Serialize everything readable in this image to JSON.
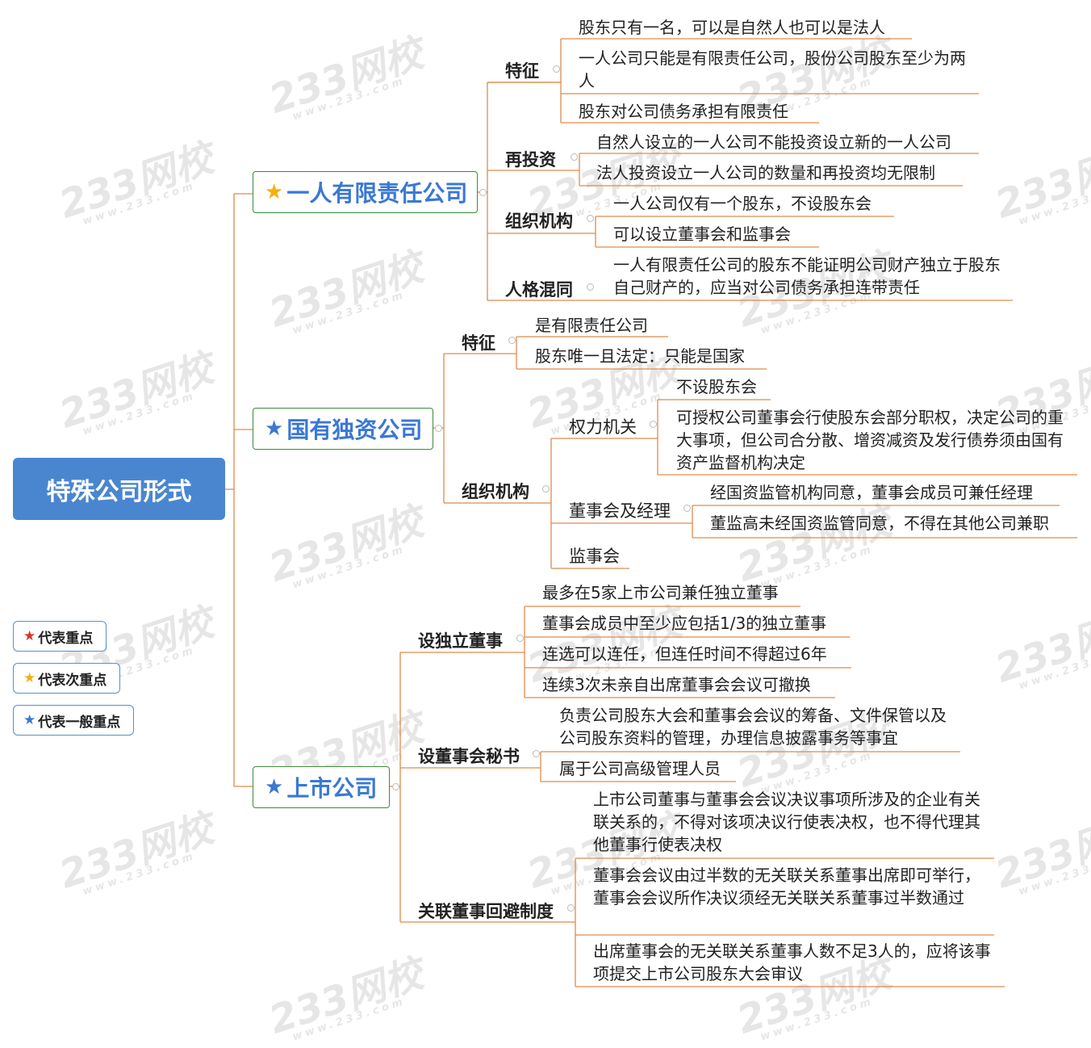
{
  "root": "特殊公司形式",
  "watermark": {
    "text": "233网校",
    "sub": "www.233.com"
  },
  "legend": [
    {
      "label": "代表重点",
      "color": "#e03030"
    },
    {
      "label": "代表次重点",
      "color": "#f2b010"
    },
    {
      "label": "代表一般重点",
      "color": "#3a78d4"
    }
  ],
  "branch1": {
    "title": "一人有限责任公司",
    "star_color": "#f2b010",
    "s1": {
      "label": "特征",
      "leaves": [
        "股东只有一名，可以是自然人也可以是法人",
        "一人公司只能是有限责任公司，股份公司股东至少为两人",
        "股东对公司债务承担有限责任"
      ]
    },
    "s2": {
      "label": "再投资",
      "leaves": [
        "自然人设立的一人公司不能投资设立新的一人公司",
        "法人投资设立一人公司的数量和再投资均无限制"
      ]
    },
    "s3": {
      "label": "组织机构",
      "leaves": [
        "一人公司仅有一个股东，不设股东会",
        "可以设立董事会和监事会"
      ]
    },
    "s4": {
      "label": "人格混同",
      "leaves": [
        "一人有限责任公司的股东不能证明公司财产独立于股东自己财产的，应当对公司债务承担连带责任"
      ]
    }
  },
  "branch2": {
    "title": "国有独资公司",
    "star_color": "#3a78d4",
    "s1": {
      "label": "特征",
      "leaves": [
        "是有限责任公司",
        "股东唯一且法定：只能是国家"
      ]
    },
    "s2": {
      "label": "组织机构",
      "c1": {
        "label": "权力机关",
        "leaves": [
          "不设股东会",
          "可授权公司董事会行使股东会部分职权，决定公司的重大事项，但公司合分散、增资减资及发行债券须由国有资产监督机构决定"
        ]
      },
      "c2": {
        "label": "董事会及经理",
        "leaves": [
          "经国资监管机构同意，董事会成员可兼任经理",
          "董监高未经国资监管同意，不得在其他公司兼职"
        ]
      },
      "c3": {
        "label": "监事会"
      }
    }
  },
  "branch3": {
    "title": "上市公司",
    "star_color": "#3a78d4",
    "s1": {
      "label": "设独立董事",
      "leaves": [
        "最多在5家上市公司兼任独立董事",
        "董事会成员中至少应包括1/3的独立董事",
        "连选可以连任，但连任时间不得超过6年",
        "连续3次未亲自出席董事会会议可撤换"
      ]
    },
    "s2": {
      "label": "设董事会秘书",
      "leaves": [
        "负责公司股东大会和董事会会议的筹备、文件保管以及公司股东资料的管理，办理信息披露事务等事宜",
        "属于公司高级管理人员"
      ]
    },
    "s3": {
      "label": "关联董事回避制度",
      "leaves": [
        "上市公司董事与董事会会议决议事项所涉及的企业有关联关系的，不得对该项决议行使表决权，也不得代理其他董事行使表决权",
        "董事会会议由过半数的无关联关系董事出席即可举行，董事会会议所作决议须经无关联关系董事过半数通过",
        "出席董事会的无关联关系董事人数不足3人的，应将该事项提交上市公司股东大会审议"
      ]
    }
  }
}
